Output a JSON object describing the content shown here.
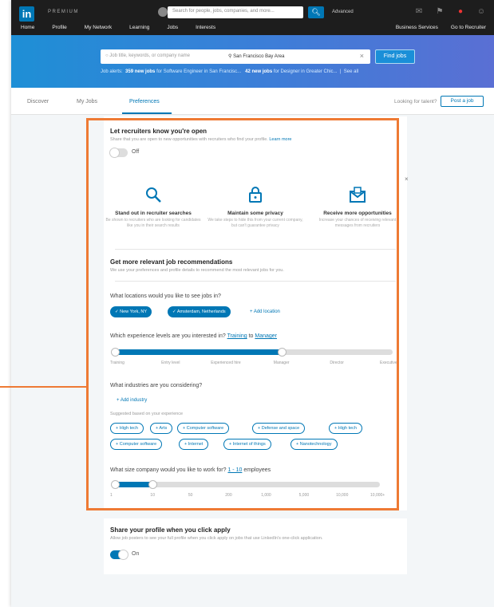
{
  "topbar": {
    "logo": "in",
    "premium": "PREMIUM",
    "search_placeholder": "Search for people, jobs, companies, and more...",
    "advanced": "Advanced",
    "nav": [
      "Home",
      "Profile",
      "My Network",
      "Learning",
      "Jobs",
      "Interests"
    ],
    "nav_right": [
      "Business Services",
      "Go to Recruiter"
    ]
  },
  "banner": {
    "keyword_placeholder": "Job title, keywords, or company name",
    "location": "San Francisco Bay Area",
    "find_jobs": "Find jobs",
    "alerts_label": "Job alerts:",
    "alert1_bold": "359 new jobs",
    "alert1_rest": "for Software Engineer in San Francisc...",
    "alert2_bold": "42 new jobs",
    "alert2_rest": "for Designer in Greater Chic...",
    "see_all": "See all"
  },
  "tabs": {
    "items": [
      "Discover",
      "My Jobs",
      "Preferences"
    ],
    "looking": "Looking for talent?",
    "post_job": "Post a job"
  },
  "recruiters": {
    "title": "Let recruiters know you're open",
    "desc": "Share that you are open to new opportunities with recruiters who find your profile.",
    "learn_more": "Learn more",
    "toggle_label": "Off",
    "features": [
      {
        "title": "Stand out in recruiter searches",
        "desc": "Be shown to recruiters who are looking for candidates like you in their search results"
      },
      {
        "title": "Maintain some privacy",
        "desc": "We take steps to hide this from your current company, but can't guarantee privacy"
      },
      {
        "title": "Receive more opportunities",
        "desc": "Increase your chances of receiving relevant messages from recruiters"
      }
    ]
  },
  "recommendations": {
    "title": "Get more relevant job recommendations",
    "desc": "We use your preferences and profile details to recommend the most relevant jobs for you.",
    "locations_q": "What locations would you like to see jobs in?",
    "locations": [
      "New York, NY",
      "Amsterdam, Netherlands"
    ],
    "add_location": "+ Add location",
    "experience_q": "Which experience levels are you interested in?",
    "experience_from": "Training",
    "experience_to": "Manager",
    "experience_to_word": "to",
    "experience_ticks": [
      "Training",
      "Entry level",
      "Experienced hire",
      "Manager",
      "Director",
      "Executive"
    ],
    "experience_range": [
      0,
      3
    ],
    "industries_q": "What industries are you considering?",
    "add_industry": "+ Add industry",
    "suggested": "Suggested based on your experience",
    "industries": [
      "+ High tech",
      "+ Arts",
      "+ Computer software",
      "+ Defense and space",
      "+ High tech",
      "+ Computer software",
      "+ Internet",
      "+ Internet of things",
      "+ Nanotechnology"
    ],
    "size_q": "What size company would you like to work for?",
    "size_range": "1 - 10",
    "size_unit": "employees",
    "size_ticks": [
      "1",
      "10",
      "50",
      "200",
      "1,000",
      "5,000",
      "10,000",
      "10,000+"
    ],
    "size_selected": [
      0,
      1
    ]
  },
  "share": {
    "title": "Share your profile when you click apply",
    "desc": "Allow job posters to see your full profile when you click apply on jobs that use LinkedIn's one-click application.",
    "toggle_label": "On"
  },
  "colors": {
    "accent": "#0077b5",
    "highlight": "#ee7a34"
  }
}
